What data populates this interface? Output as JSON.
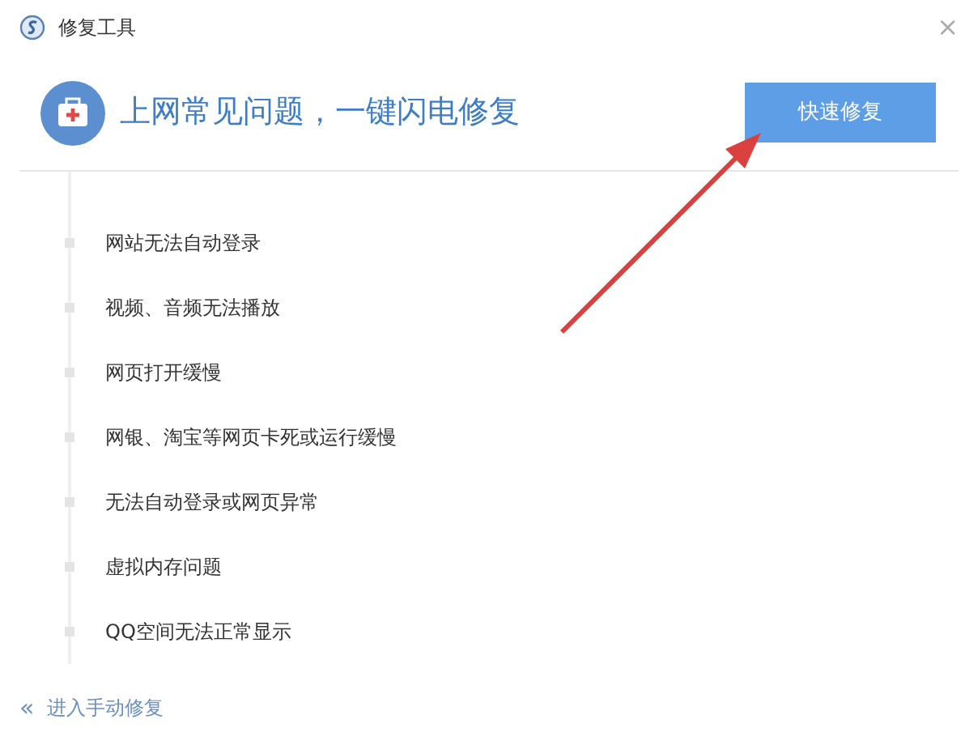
{
  "window": {
    "title": "修复工具",
    "close": "×"
  },
  "header": {
    "title": "上网常见问题，一键闪电修复",
    "button": "快速修复"
  },
  "issues": [
    {
      "label": "网站无法自动登录"
    },
    {
      "label": "视频、音频无法播放"
    },
    {
      "label": "网页打开缓慢"
    },
    {
      "label": "网银、淘宝等网页卡死或运行缓慢"
    },
    {
      "label": "无法自动登录或网页异常"
    },
    {
      "label": "虚拟内存问题"
    },
    {
      "label": "QQ空间无法正常显示"
    }
  ],
  "footer": {
    "icon": "«",
    "link": "进入手动修复"
  }
}
